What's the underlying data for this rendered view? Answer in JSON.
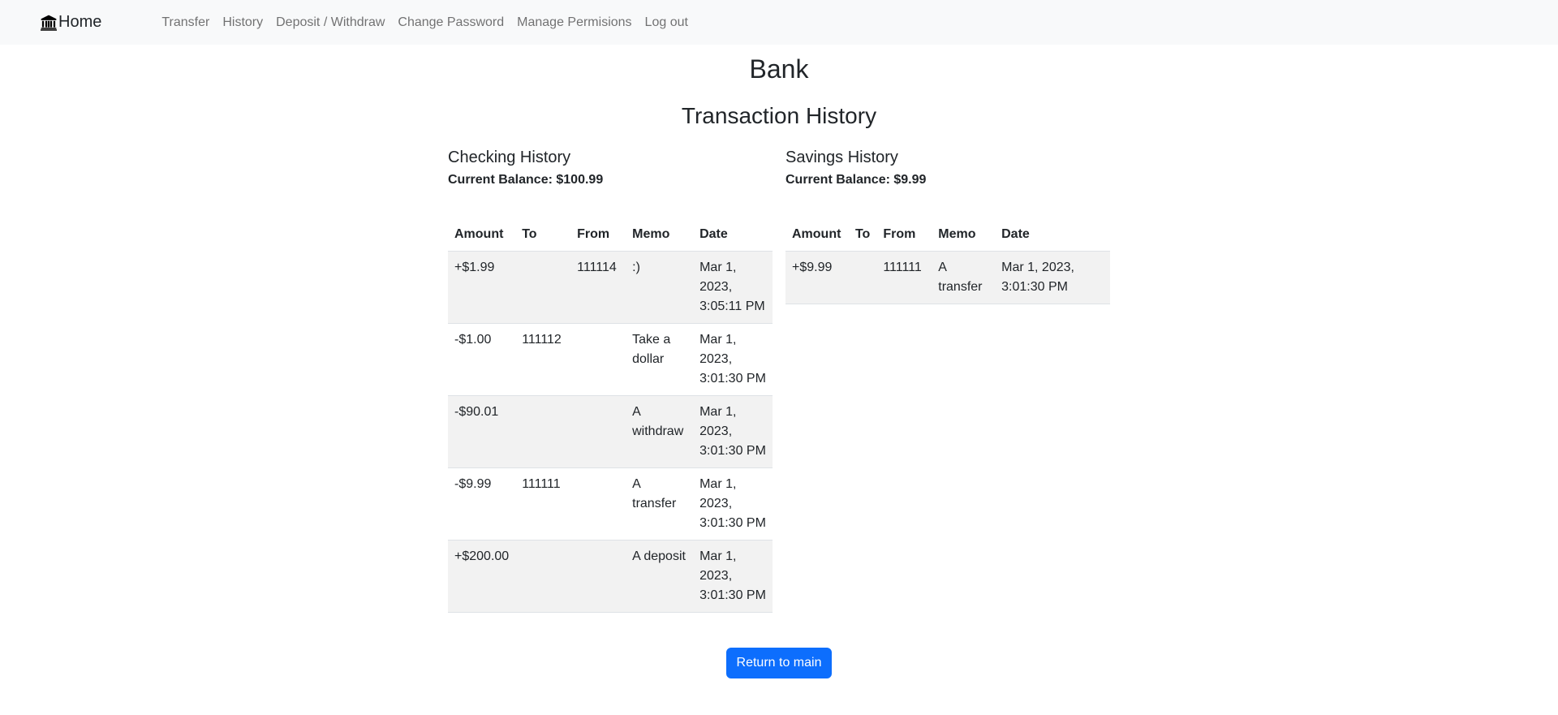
{
  "navbar": {
    "brand_icon": "bank-icon",
    "brand_label": "Home",
    "links": [
      {
        "label": "Transfer"
      },
      {
        "label": "History"
      },
      {
        "label": "Deposit / Withdraw"
      },
      {
        "label": "Change Password"
      },
      {
        "label": "Manage Permisions"
      },
      {
        "label": "Log out"
      }
    ]
  },
  "main": {
    "title": "Bank",
    "section_title": "Transaction History",
    "checking": {
      "heading": "Checking History",
      "balance_label": "Current Balance:",
      "balance_value": "$100.99",
      "columns": [
        "Amount",
        "To",
        "From",
        "Memo",
        "Date"
      ],
      "rows": [
        {
          "amount": "+$1.99",
          "to": "",
          "from": "111114",
          "memo": ":)",
          "date": "Mar 1, 2023, 3:05:11 PM"
        },
        {
          "amount": "-$1.00",
          "to": "111112",
          "from": "",
          "memo": "Take a dollar",
          "date": "Mar 1, 2023, 3:01:30 PM"
        },
        {
          "amount": "-$90.01",
          "to": "",
          "from": "",
          "memo": "A withdraw",
          "date": "Mar 1, 2023, 3:01:30 PM"
        },
        {
          "amount": "-$9.99",
          "to": "111111",
          "from": "",
          "memo": "A transfer",
          "date": "Mar 1, 2023, 3:01:30 PM"
        },
        {
          "amount": "+$200.00",
          "to": "",
          "from": "",
          "memo": "A deposit",
          "date": "Mar 1, 2023, 3:01:30 PM"
        }
      ]
    },
    "savings": {
      "heading": "Savings History",
      "balance_label": "Current Balance:",
      "balance_value": "$9.99",
      "columns": [
        "Amount",
        "To",
        "From",
        "Memo",
        "Date"
      ],
      "rows": [
        {
          "amount": "+$9.99",
          "to": "",
          "from": "111111",
          "memo": "A transfer",
          "date": "Mar 1, 2023, 3:01:30 PM"
        }
      ]
    },
    "return_button_label": "Return to main"
  },
  "colors": {
    "navbar_bg": "#f8f9fa",
    "primary": "#0d6efd",
    "stripe": "#f2f2f2"
  }
}
